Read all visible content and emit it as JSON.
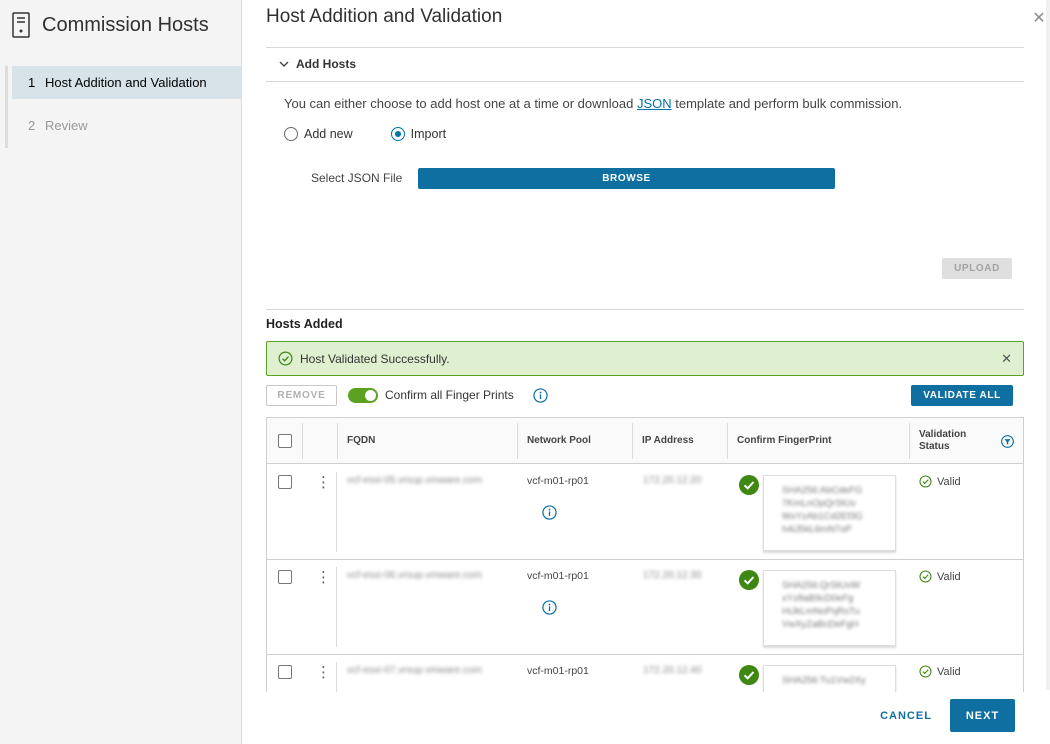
{
  "sidebar": {
    "title": "Commission Hosts",
    "icon": "server-icon",
    "steps": [
      {
        "num": "1",
        "label": "Host Addition and Validation",
        "active": true
      },
      {
        "num": "2",
        "label": "Review",
        "active": false
      }
    ]
  },
  "main": {
    "title": "Host Addition and Validation",
    "close_icon": "close-icon",
    "accordion_title": "Add Hosts",
    "intro_before": "You can either choose to add host one at a time or download ",
    "intro_link": "JSON",
    "intro_after": " template and perform bulk commission.",
    "radio_add_new": "Add new",
    "radio_import": "Import",
    "selected_radio": "Import",
    "json_file_label": "Select JSON File",
    "browse_label": "BROWSE",
    "upload_label": "UPLOAD",
    "hosts_added_title": "Hosts Added",
    "alert_text": "Host Validated Successfully.",
    "remove_label": "REMOVE",
    "confirm_toggle_label": "Confirm all Finger Prints",
    "confirm_toggle_on": true,
    "validate_all_label": "VALIDATE ALL"
  },
  "table": {
    "columns": {
      "fqdn": "FQDN",
      "network_pool": "Network Pool",
      "ip_address": "IP Address",
      "confirm_fingerprint": "Confirm FingerPrint",
      "validation_status": "Validation Status"
    },
    "rows": [
      {
        "fqdn": "vcf-esxi-05.vrsup.vmware.com",
        "network_pool": "vcf-m01-rp01",
        "ip": "172.20.12.20",
        "fingerprint": [
          "SHA256:AbCdeFG",
          "7KmLnOpQrStUv",
          "WxYzAb1Cd2Ef3G",
          "h4iJ5kL6mN7oP"
        ],
        "status": "Valid"
      },
      {
        "fqdn": "vcf-esxi-06.vrsup.vmware.com",
        "network_pool": "vcf-m01-rp01",
        "ip": "172.20.12.30",
        "fingerprint": [
          "SHA256:QrStUvW",
          "xYz8aB9cD0eFg",
          "HiJkLmNoPqRsTu",
          "VwXyZaBcDeFgH"
        ],
        "status": "Valid"
      },
      {
        "fqdn": "vcf-esxi-07.vrsup.vmware.com",
        "network_pool": "vcf-m01-rp01",
        "ip": "172.20.12.40",
        "fingerprint": [
          "SHA256:Tu1Vw2Xy"
        ],
        "status": "Valid"
      }
    ]
  },
  "footer": {
    "cancel_label": "CANCEL",
    "next_label": "NEXT"
  },
  "colors": {
    "primary": "#0f6fa0",
    "success": "#5aa220",
    "alert_bg": "#dff0d0"
  }
}
